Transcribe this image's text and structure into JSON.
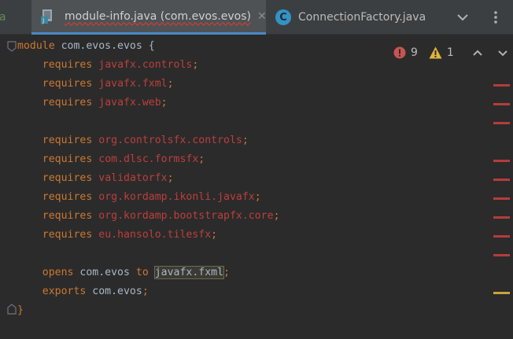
{
  "tabs": [
    {
      "label": "a",
      "partial": true
    },
    {
      "label": "module-info.java (com.evos.evos)",
      "active": true,
      "close": "✕"
    },
    {
      "label": "ConnectionFactory.java",
      "icon_letter": "C",
      "active": false
    }
  ],
  "tab_bar_buttons": [
    "chevron-down-icon",
    "more-vertical-icon"
  ],
  "inspection": {
    "errors": "9",
    "warnings": "1"
  },
  "code_lines": [
    {
      "kw": "module",
      "rest": " com.evos.evos {"
    },
    {
      "indent": "    ",
      "kw": "requires",
      "pkg": "javafx.controls",
      "end": ";"
    },
    {
      "indent": "    ",
      "kw": "requires",
      "pkg": "javafx.fxml",
      "end": ";"
    },
    {
      "indent": "    ",
      "kw": "requires",
      "pkg": "javafx.web",
      "end": ";"
    },
    {},
    {
      "indent": "    ",
      "kw": "requires",
      "pkg": "org.controlsfx.controls",
      "end": ";"
    },
    {
      "indent": "    ",
      "kw": "requires",
      "pkg": "com.dlsc.formsfx",
      "end": ";"
    },
    {
      "indent": "    ",
      "kw": "requires",
      "pkg": "validatorfx",
      "end": ";"
    },
    {
      "indent": "    ",
      "kw": "requires",
      "pkg": "org.kordamp.ikonli.javafx",
      "end": ";"
    },
    {
      "indent": "    ",
      "kw": "requires",
      "pkg": "org.kordamp.bootstrapfx.core",
      "end": ";"
    },
    {
      "indent": "    ",
      "kw": "requires",
      "pkg": "eu.hansolo.tilesfx",
      "end": ";"
    },
    {},
    {
      "indent": "    ",
      "kw": "opens",
      "a": " com.evos ",
      "kw2": "to",
      "hl": "javafx.fxml",
      "end": ";"
    },
    {
      "indent": "    ",
      "kw": "exports",
      "a": " com.evos",
      "end": ";"
    },
    {
      "kw": "}"
    }
  ],
  "colors": {
    "background": "#2b2b2b",
    "keyword": "#cc7832",
    "unresolved": "#bc3f3c",
    "identifier": "#a9b7c6",
    "error_marker": "#b53c3c",
    "warning_marker": "#c9a534",
    "tab_accent": "#4a88c7"
  }
}
